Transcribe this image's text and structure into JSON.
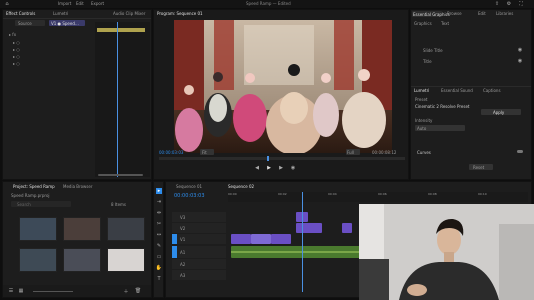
{
  "menu": {
    "items": [
      "Import",
      "Edit",
      "Export"
    ],
    "window_title": "Speed Ramp — Edited"
  },
  "source_panel": {
    "tabs": [
      "Effect Controls",
      "Lumetri",
      "Audio Clip Mixer"
    ],
    "source_label": "Source",
    "clip_label": "V1 ● Speed…"
  },
  "program_panel": {
    "tab": "Program: Sequence 01",
    "timecode_left": "00:00:03:03",
    "fit_label": "Fit",
    "full_label": "Full",
    "timecode_right": "00:00:08:12"
  },
  "essential": {
    "tabs": [
      "Essential Graphics",
      "Browse",
      "Edit",
      "Libraries"
    ],
    "sub_tabs": [
      "Graphics",
      "Text"
    ],
    "rows": [
      "Slide Title",
      "Title"
    ],
    "section_tabs": [
      "Lumetri",
      "Essential Sound",
      "Captions"
    ],
    "preset_label": "Preset",
    "preset_value": "Cinematic 2 Resolve Preset",
    "apply_button": "Apply",
    "intensity_label": "Intensity",
    "intensity_value": "Auto",
    "curve_label": "Curves",
    "reset_button": "Reset",
    "hsl_label": "HSL Secondary"
  },
  "project_panel": {
    "tabs": [
      "Project: Speed Ramp",
      "Media Browser"
    ],
    "path": "Speed Ramp.prproj",
    "search_placeholder": "Search",
    "items_count": "8 Items"
  },
  "timeline": {
    "tabs": [
      "Sequence 01",
      "Sequence 02"
    ],
    "timecode": "00:00:03:03",
    "ruler": [
      "00:00",
      "00:02",
      "00:04",
      "00:06",
      "00:08",
      "00:10"
    ],
    "tracks": [
      "V3",
      "V2",
      "V1",
      "A1",
      "A2",
      "A3"
    ]
  },
  "colors": {
    "accent_blue": "#2d8ceb",
    "video_clip": "#6a4fc4",
    "audio_clip": "#4a7a2e",
    "playhead": "#4a90e2"
  }
}
